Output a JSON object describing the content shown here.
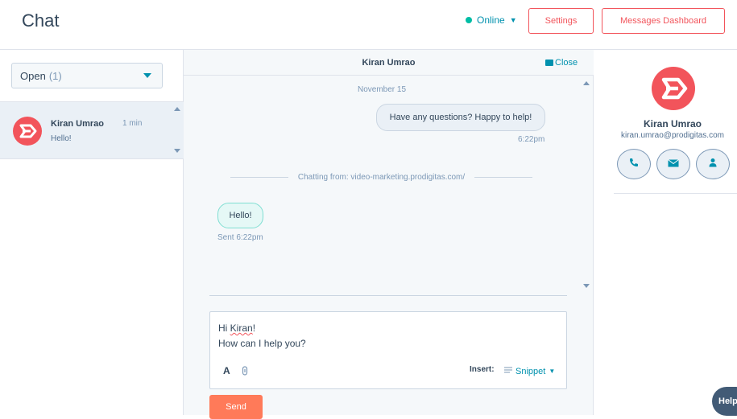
{
  "header": {
    "title": "Chat",
    "status": "Online",
    "settings_label": "Settings",
    "dashboard_label": "Messages Dashboard"
  },
  "sidebar": {
    "filter_label": "Open",
    "filter_count": "(1)",
    "conversations": [
      {
        "name": "Kiran Umrao",
        "time": "1 min",
        "preview": "Hello!"
      }
    ]
  },
  "conversation": {
    "title": "Kiran Umrao",
    "close_label": "Close",
    "date": "November 15",
    "messages": [
      {
        "text": "Have any questions? Happy to help!",
        "time": "6:22pm"
      },
      {
        "text": "Hello!",
        "time": "Sent 6:22pm"
      }
    ],
    "chatting_from": "Chatting from: video-marketing.prodigitas.com/",
    "composer": {
      "greeting_prefix": "Hi ",
      "greeting_name": "Kiran",
      "greeting_suffix": "!",
      "line2": "How can I help you?",
      "format_label": "A",
      "insert_label": "Insert:",
      "snippet_label": "Snippet"
    },
    "send_label": "Send"
  },
  "contact": {
    "name": "Kiran Umrao",
    "email": "kiran.umrao@prodigitas.com"
  },
  "help_label": "Help",
  "colors": {
    "accent": "#0091ae",
    "brand": "#f2545b",
    "send": "#ff7a59",
    "online": "#00bda5"
  },
  "icons": [
    "chevron-down-icon",
    "envelope-icon",
    "phone-icon",
    "email-icon",
    "contact-icon",
    "link-icon",
    "snippet-icon",
    "brand-logo"
  ]
}
